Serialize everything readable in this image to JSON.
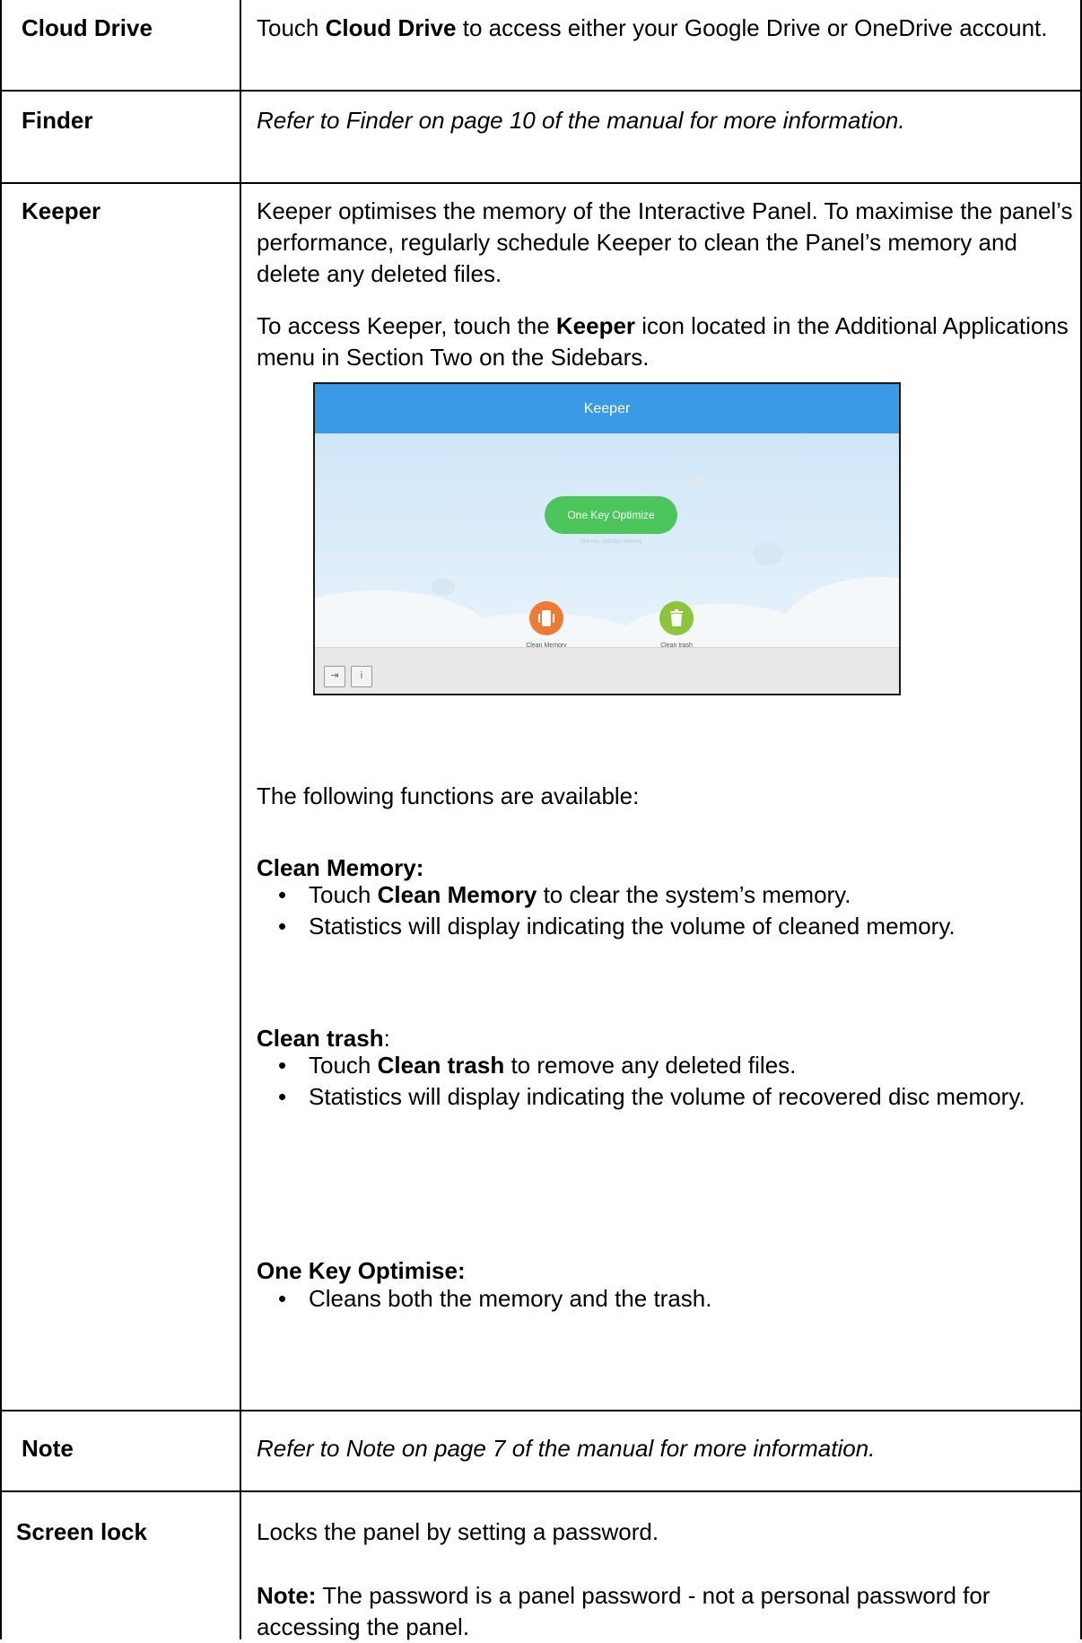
{
  "rows": [
    {
      "label": "Cloud Drive",
      "desc": {
        "pre": "Touch ",
        "bold": "Cloud Drive",
        "post": " to access either your Google Drive or OneDrive account."
      }
    },
    {
      "label": "Finder",
      "desc_italic": "Refer to Finder on page 10 of the manual for more information."
    },
    {
      "label": "Keeper",
      "para1": "Keeper optimises the memory of the Interactive Panel.  To maximise the panel’s performance, regularly schedule Keeper to clean the Panel’s memory and delete any deleted files.",
      "para2": {
        "pre": "To access Keeper, touch the ",
        "bold": "Keeper",
        "post": " icon located in the Additional Applications menu in Section Two on the Sidebars."
      },
      "screenshot": {
        "title": "Keeper",
        "optimize_button": "One Key Optimize",
        "optimize_subtitle": "One key optimize memory",
        "clean_memory_label": "Clean Memory",
        "clean_trash_label": "Clean trash",
        "accent_color": "#3a9ae5",
        "optimize_color": "#4cc65a",
        "memory_color": "#ee7a33",
        "trash_color": "#8cc43a"
      },
      "functions_intro": "The following functions are available:",
      "clean_memory": {
        "heading": "Clean Memory:",
        "bullet1": {
          "pre": "Touch ",
          "bold": "Clean Memory",
          "post": " to clear the system’s memory."
        },
        "bullet2": "Statistics will display indicating the volume of cleaned memory."
      },
      "clean_trash": {
        "heading": "Clean trash",
        "heading_suffix": ":",
        "bullet1": {
          "pre": "Touch ",
          "bold": "Clean trash",
          "post": " to remove any deleted files."
        },
        "bullet2": "Statistics will display indicating the volume of recovered disc memory."
      },
      "one_key": {
        "heading": "One Key Optimise:",
        "bullet1": "Cleans both the memory and the trash."
      }
    },
    {
      "label": "Note",
      "desc_italic": "Refer to Note on page 7 of the manual for more information."
    },
    {
      "label": "Screen lock",
      "para1": "Locks the panel by setting a password.",
      "note": {
        "bold": "Note:",
        "post": " The password is a panel password - not a personal password for accessing the panel."
      }
    }
  ]
}
